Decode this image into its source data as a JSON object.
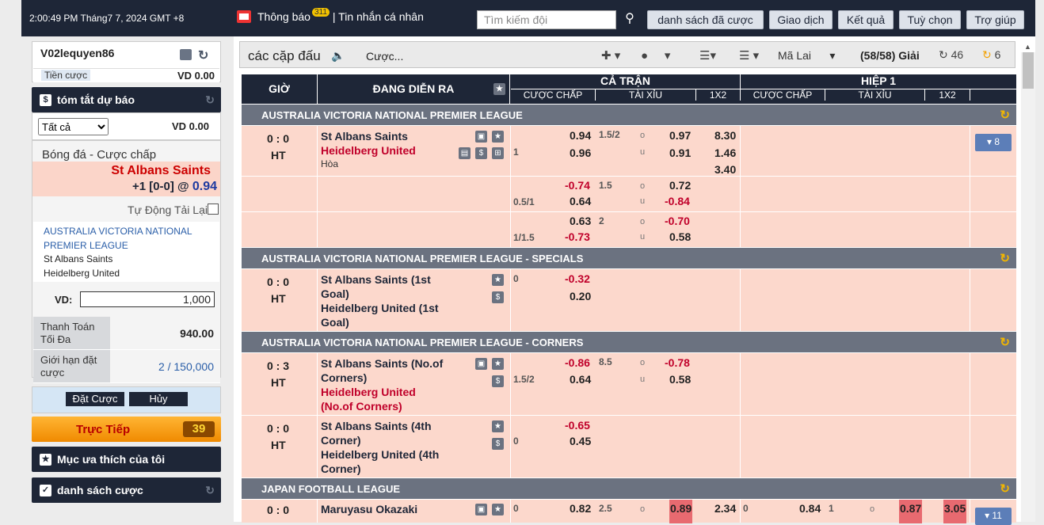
{
  "header": {
    "clock": "2:00:49 PM Tháng7 7, 2024 GMT +8",
    "notify": "Thông báo",
    "notify_count": "311",
    "messages": "| Tin nhắn cá nhân",
    "search_placeholder": "Tìm kiếm đội",
    "buttons": [
      "danh sách đã cược",
      "Giao dịch",
      "Kết quả",
      "Tuỳ chọn",
      "Trợ giúp"
    ]
  },
  "account": {
    "username": "V02lequyen86",
    "credit_label": "Tiền cược",
    "credit_value": "VD  0.00"
  },
  "summary": {
    "title": "tóm tắt dự báo",
    "select": "Tất cả",
    "value": "VD 0.00"
  },
  "slip": {
    "title": "Bóng đá - Cược chấp",
    "team": "St Albans Saints",
    "odd_prefix": "+1 [0-0] @",
    "odd": "0.94",
    "auto_reload": "Tự Động Tải Lại",
    "league": "AUSTRALIA VICTORIA NATIONAL PREMIER LEAGUE",
    "home": "St Albans Saints",
    "away": "Heidelberg United",
    "vd_label": "VD:",
    "vd_value": "1,000",
    "max_payout_label": "Thanh Toán Tối Đa",
    "max_payout": "940.00",
    "limit_label": "Giới hạn đặt cược",
    "limit": "2 / 150,000",
    "place": "Đặt Cược",
    "cancel": "Hủy"
  },
  "live": {
    "label": "Trực Tiếp",
    "count": "39"
  },
  "favorites": "Mục ưa thích của tôi",
  "bet_list": "danh sách cược",
  "toolbar": {
    "title": "các cặp đấu",
    "bets": "Cược...",
    "odds_type": "Mã Lai",
    "count": "(58/58) Giải",
    "refresh1": "46",
    "refresh2": "6"
  },
  "table_header": {
    "time": "GIỜ",
    "live": "ĐANG DIỄN RA",
    "full": "CẢ TRẬN",
    "half": "HIỆP 1",
    "hdp": "CƯỢC CHẤP",
    "ou": "TÀI XỈU",
    "x12": "1X2"
  },
  "sections": [
    {
      "name": "AUSTRALIA VICTORIA NATIONAL PREMIER LEAGUE"
    },
    {
      "name": "AUSTRALIA VICTORIA NATIONAL PREMIER LEAGUE - SPECIALS"
    },
    {
      "name": "AUSTRALIA VICTORIA NATIONAL PREMIER LEAGUE - CORNERS"
    },
    {
      "name": "JAPAN FOOTBALL LEAGUE"
    }
  ],
  "matches": {
    "m1": {
      "score": "0 : 0",
      "status": "HT",
      "home": "St Albans Saints",
      "away": "Heidelberg United",
      "draw": "Hòa",
      "hdp": "1",
      "h1": "0.94",
      "h2": "0.96",
      "ou": "1.5/2",
      "o": "o",
      "u": "u",
      "o1": "0.97",
      "o2": "0.91",
      "x1": "8.30",
      "x2": "1.46",
      "x3": "3.40",
      "more": "▾ 8"
    },
    "m1b": {
      "h1": "-0.74",
      "h2": "0.64",
      "hdp": "0.5/1",
      "ou": "1.5",
      "o": "o",
      "u": "u",
      "o1": "0.72",
      "o2": "-0.84"
    },
    "m1c": {
      "h1": "0.63",
      "h2": "-0.73",
      "hdp": "1/1.5",
      "ou": "2",
      "o": "o",
      "u": "u",
      "o1": "-0.70",
      "o2": "0.58"
    },
    "m2": {
      "score": "0 : 0",
      "status": "HT",
      "home": "St Albans Saints (1st",
      "home2": "Goal)",
      "away": "Heidelberg United (1st",
      "away2": "Goal)",
      "hdp": "0",
      "h1": "-0.32",
      "h2": "0.20"
    },
    "m3": {
      "score": "0 : 3",
      "status": "HT",
      "home": "St Albans Saints (No.of",
      "home2": "Corners)",
      "away": "Heidelberg United",
      "away2": "(No.of Corners)",
      "hdp": "1.5/2",
      "h1": "-0.86",
      "h2": "0.64",
      "ou": "8.5",
      "o": "o",
      "u": "u",
      "o1": "-0.78",
      "o2": "0.58"
    },
    "m4": {
      "score": "0 : 0",
      "status": "HT",
      "home": "St Albans Saints (4th",
      "home2": "Corner)",
      "away": "Heidelberg United (4th",
      "away2": "Corner)",
      "hdp": "0",
      "h1": "-0.65",
      "h2": "0.45"
    },
    "m5": {
      "score": "0 : 0",
      "home": "Maruyasu Okazaki",
      "hdp": "0",
      "h1": "0.82",
      "ou": "2.5",
      "o": "o",
      "o1": "0.89",
      "x1": "2.34",
      "hhdp": "0",
      "hh1": "0.84",
      "hou": "1",
      "ho": "o",
      "ho1": "0.87",
      "hx1": "3.05",
      "more": "▾ 11"
    }
  }
}
